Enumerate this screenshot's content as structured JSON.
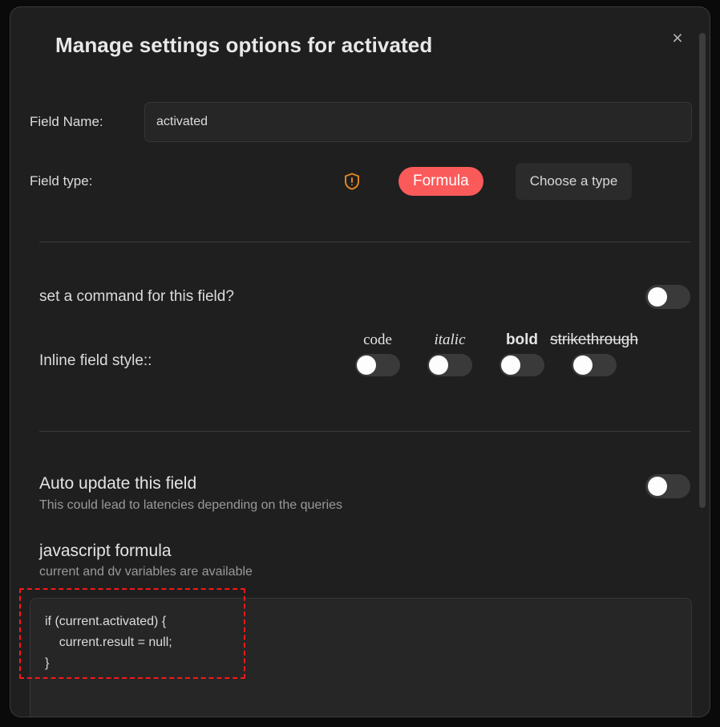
{
  "modal": {
    "title": "Manage settings options for activated",
    "close_icon": "close-icon",
    "close_label": "×"
  },
  "field_name": {
    "label": "Field Name:",
    "value": "activated",
    "placeholder": "Field name"
  },
  "field_type": {
    "label": "Field type:",
    "warning_icon": "shield-exclamation-icon",
    "badge_label": "Formula",
    "badge_color": "#fb5a5a",
    "choose_button_label": "Choose a type"
  },
  "command": {
    "label": "set a command for this field?",
    "toggle_state": "off"
  },
  "inline_style": {
    "label": "Inline field style::",
    "options": [
      {
        "label": "code",
        "toggle_state": "off"
      },
      {
        "label": "italic",
        "toggle_state": "off"
      },
      {
        "label": "bold",
        "toggle_state": "off"
      },
      {
        "label": "strikethrough",
        "toggle_state": "off"
      }
    ]
  },
  "auto_update": {
    "heading": "Auto update this field",
    "description": "This could lead to latencies depending on the queries",
    "toggle_state": "off"
  },
  "formula": {
    "heading": "javascript formula",
    "description": "current and dv variables are available",
    "code_lines": [
      "if (current.activated) {",
      "    current.result = null;",
      "}"
    ]
  },
  "annotation": {
    "color": "#f81818",
    "style": "dashed-rectangle"
  },
  "theme": {
    "page_background": "#0a0a0a",
    "modal_background": "#1f1f1f",
    "input_background": "#262626",
    "accent": "#fb5a5a",
    "warning": "#e0841f",
    "text_primary": "#e4e4e4",
    "text_muted": "#9a9a9a"
  }
}
